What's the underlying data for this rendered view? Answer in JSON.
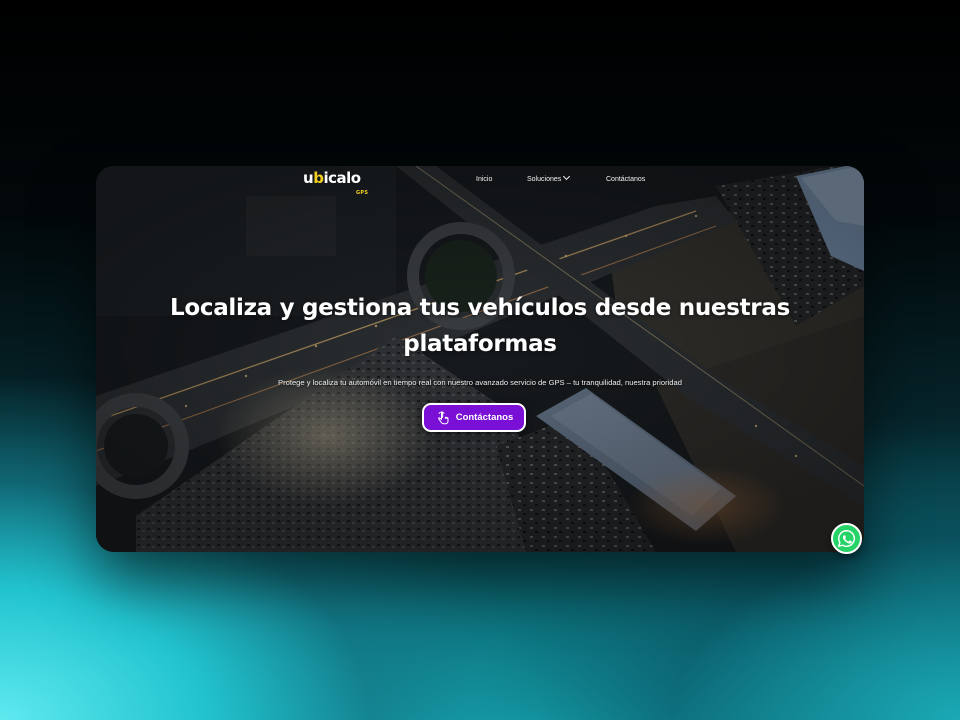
{
  "brand": {
    "logo_pre": "u",
    "logo_accent": "b",
    "logo_post": "icalo",
    "logo_sub": "GPS",
    "accent_color": "#f2cf1f"
  },
  "nav": {
    "items": [
      {
        "label": "Inicio"
      },
      {
        "label": "Soluciones",
        "has_dropdown": true,
        "icon": "chevron-down-icon"
      },
      {
        "label": "Contáctanos"
      }
    ]
  },
  "hero": {
    "title": "Localiza y gestiona tus vehículos desde nuestras plataformas",
    "subtitle": "Protege y localiza tu automóvil en tiempo real con nuestro avanzado servicio de GPS – tu tranquilidad, nuestra prioridad",
    "cta_label": "Contáctanos",
    "cta_icon": "hand-pointer-icon",
    "cta_color": "#7a10d6"
  },
  "floating": {
    "whatsapp_icon": "whatsapp-icon",
    "whatsapp_color": "#25d366"
  },
  "background": {
    "image": "aerial-night-city-photo"
  }
}
